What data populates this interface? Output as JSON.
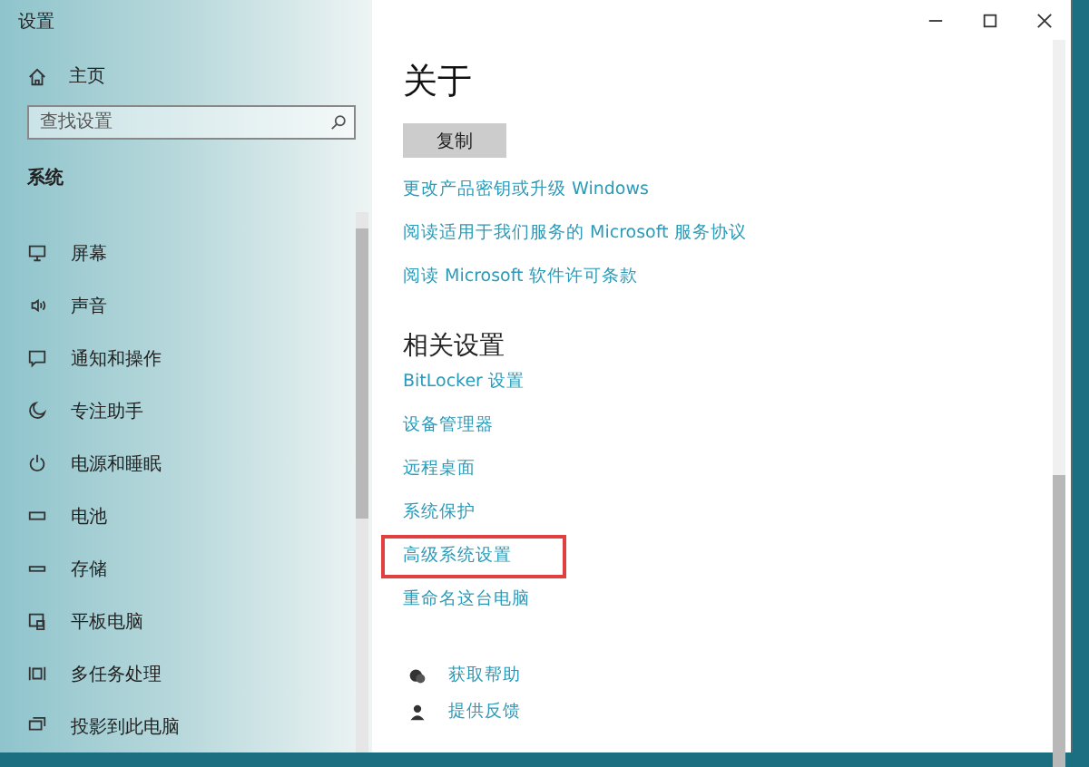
{
  "window": {
    "title": "设置"
  },
  "sidebar": {
    "home": "主页",
    "search": {
      "placeholder": "查找设置"
    },
    "section": "系统",
    "items": [
      "屏幕",
      "声音",
      "通知和操作",
      "专注助手",
      "电源和睡眠",
      "电池",
      "存储",
      "平板电脑",
      "多任务处理",
      "投影到此电脑"
    ]
  },
  "content": {
    "title": "关于",
    "copy_button": "复制",
    "links": [
      "更改产品密钥或升级 Windows",
      "阅读适用于我们服务的 Microsoft 服务协议",
      "阅读 Microsoft 软件许可条款"
    ],
    "related_title": "相关设置",
    "related_links": [
      {
        "label": "BitLocker 设置",
        "highlighted": false
      },
      {
        "label": "设备管理器",
        "highlighted": false
      },
      {
        "label": "远程桌面",
        "highlighted": false
      },
      {
        "label": "系统保护",
        "highlighted": false
      },
      {
        "label": "高级系统设置",
        "highlighted": true
      },
      {
        "label": "重命名这台电脑",
        "highlighted": false
      }
    ],
    "help": [
      "获取帮助",
      "提供反馈"
    ]
  }
}
